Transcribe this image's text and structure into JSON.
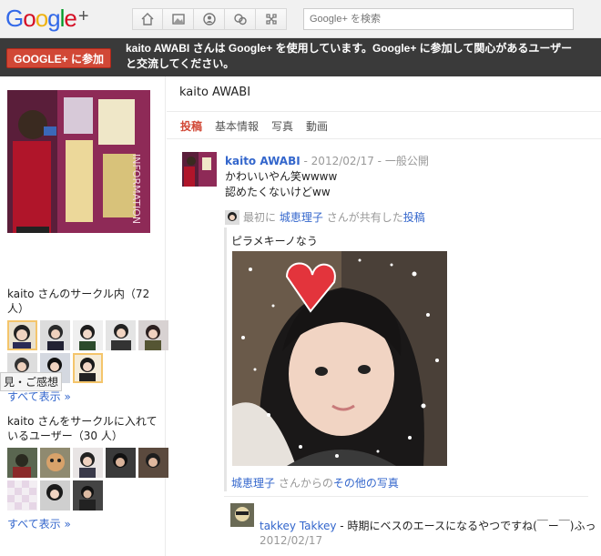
{
  "header": {
    "logo_text": "Google+",
    "search_placeholder": "Google+ を検索",
    "nav_icons": [
      "home-icon",
      "photos-icon",
      "profile-icon",
      "circles-icon",
      "games-icon"
    ]
  },
  "promo": {
    "join_label": "GOOGLE+ に参加",
    "message": "kaito AWABI さんは Google+ を使用しています。Google+ に参加して関心があるユーザーと交流してください。"
  },
  "sidebar": {
    "in_circles_title": "kaito さんのサークル内（72 人）",
    "show_all_1": "すべて表示 »",
    "tooltip": "見・ご感想",
    "circled_by_title": "kaito さんをサークルに入れているユーザー（30 人）",
    "show_all_2": "すべて表示 »"
  },
  "profile": {
    "name": "kaito AWABI",
    "tabs": [
      {
        "label": "投稿",
        "active": true
      },
      {
        "label": "基本情報",
        "active": false
      },
      {
        "label": "写真",
        "active": false
      },
      {
        "label": "動画",
        "active": false
      }
    ]
  },
  "post": {
    "author": "kaito AWABI",
    "separator1": " - ",
    "date": "2012/02/17",
    "separator2": " - ",
    "visibility": "一般公開",
    "body_line1": "かわいいやん笑wwww",
    "body_line2": "認めたくないけどww",
    "share_prefix": "最初に",
    "share_user": "城恵理子",
    "share_mid": "さんが共有した",
    "share_link": "投稿",
    "shared_text": "ピラメキーノなう",
    "more_user": "城恵理子",
    "more_mid": "さんからの",
    "more_link": "その他の写真"
  },
  "comment": {
    "author": "takkey Takkey",
    "text": " - 時期にベスのエースになるやつですね(￣ー￣)ふっ",
    "date": "2012/02/17"
  },
  "colors": {
    "accent": "#d14836",
    "link": "#3366cc",
    "promo_bg": "#3a3a3a"
  }
}
